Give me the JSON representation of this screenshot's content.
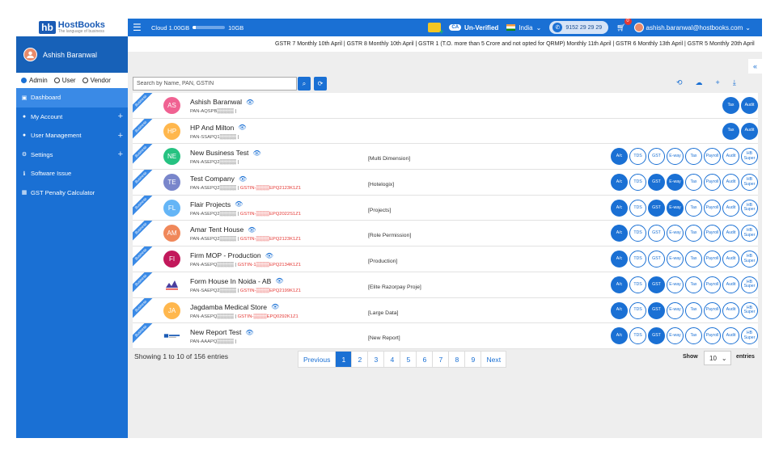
{
  "brand": {
    "logo_mark": "hb",
    "name": "HostBooks",
    "tagline": "The language of business"
  },
  "user": {
    "name": "Ashish Baranwal",
    "email": "ashish.baranwal@hostbooks.com"
  },
  "roles": [
    {
      "label": "Admin",
      "selected": true
    },
    {
      "label": "User",
      "selected": false
    },
    {
      "label": "Vendor",
      "selected": false
    }
  ],
  "nav": [
    {
      "label": "Dashboard",
      "icon": "dashboard-icon",
      "active": true,
      "expandable": false
    },
    {
      "label": "My Account",
      "icon": "account-icon",
      "active": false,
      "expandable": true
    },
    {
      "label": "User Management",
      "icon": "users-icon",
      "active": false,
      "expandable": true
    },
    {
      "label": "Settings",
      "icon": "gear-icon",
      "active": false,
      "expandable": true
    },
    {
      "label": "Software Issue",
      "icon": "info-icon",
      "active": false,
      "expandable": false
    },
    {
      "label": "GST Penalty Calculator",
      "icon": "calculator-icon",
      "active": false,
      "expandable": false
    }
  ],
  "topbar": {
    "storage_label": "Cloud 1.00GB",
    "storage_total": "10GB",
    "storage_used_fraction": 0.1,
    "ca_badge": "CA",
    "verify_status": "Un-Verified",
    "country": "India",
    "phone": "9152 29 29 29",
    "cart_count": "0"
  },
  "ticker": "GSTR 7 Monthly 10th April | GSTR 8 Monthly 10th April | GSTR 1 (T.O. more than 5 Crore and not opted for QRMP) Monthly 11th April | GSTR 6 Monthly 13th April | GSTR 5 Monthly 20th April",
  "search": {
    "placeholder": "Search by Name, PAN, GSTIN"
  },
  "row_ribbon": "Business",
  "companies": [
    {
      "initials": "AS",
      "color": "#f06292",
      "name": "Ashish Baranwal",
      "pan": "PAN-AQSPB▒▒▒▒▒ |",
      "gstin": "",
      "module": "",
      "modules": [
        "Tax",
        "Audit"
      ],
      "active": [
        "Tax",
        "Audit"
      ]
    },
    {
      "initials": "HP",
      "color": "#ffb74d",
      "name": "HP And Milton",
      "pan": "PAN-SSAPQ1▒▒▒▒▒ |",
      "gstin": "",
      "module": "",
      "modules": [
        "Tax",
        "Audit"
      ],
      "active": [
        "Tax",
        "Audit"
      ]
    },
    {
      "initials": "NE",
      "color": "#26c281",
      "name": "New Business Test",
      "pan": "PAN-ASEPQ2▒▒▒▒▒ |",
      "gstin": "",
      "module": "[Multi Dimension]",
      "modules": [
        "A/c",
        "TDS",
        "GST",
        "E-way",
        "Tax",
        "Payroll",
        "Audit",
        "HB Super"
      ],
      "active": [
        "A/c"
      ]
    },
    {
      "initials": "TE",
      "color": "#7986cb",
      "name": "Test Company",
      "pan": "PAN-ASEPQ2▒▒▒▒▒ |",
      "gstin": "GSTIN-▒▒▒▒EPQ2123K1Z1",
      "module": "[Hotelogix]",
      "modules": [
        "A/c",
        "TDS",
        "GST",
        "E-way",
        "Tax",
        "Payroll",
        "Audit",
        "HB Super"
      ],
      "active": [
        "A/c",
        "GST",
        "E-way"
      ]
    },
    {
      "initials": "FL",
      "color": "#64b5f6",
      "name": "Flair Projects",
      "pan": "PAN-ASEPQ2▒▒▒▒▒ |",
      "gstin": "GSTIN-▒▒▒▒EPQ2022S1Z1",
      "module": "[Projects]",
      "modules": [
        "A/c",
        "TDS",
        "GST",
        "E-way",
        "Tax",
        "Payroll",
        "Audit",
        "HB Super"
      ],
      "active": [
        "A/c",
        "GST",
        "E-way"
      ]
    },
    {
      "initials": "AM",
      "color": "#f0885a",
      "name": "Amar Tent House",
      "pan": "PAN-ASEPQ2▒▒▒▒▒ |",
      "gstin": "GSTIN-▒▒▒▒EPQ2123K1Z1",
      "module": "[Role Permission]",
      "modules": [
        "A/c",
        "TDS",
        "GST",
        "E-way",
        "Tax",
        "Payroll",
        "Audit",
        "HB Super"
      ],
      "active": [
        "A/c"
      ]
    },
    {
      "initials": "FI",
      "color": "#c2185b",
      "name": "Firm MOP - Production",
      "pan": "PAN-ASEPQ▒▒▒▒▒ |",
      "gstin": "GSTIN-1▒▒▒▒EPQ2134K1Z1",
      "module": "[Production]",
      "modules": [
        "A/c",
        "TDS",
        "GST",
        "E-way",
        "Tax",
        "Payroll",
        "Audit",
        "HB Super"
      ],
      "active": [
        "A/c"
      ]
    },
    {
      "initials": "",
      "color": "logo",
      "name": "Form House In Noida - AB",
      "pan": "PAN-SAEPQ2▒▒▒▒▒ |",
      "gstin": "GSTIN-▒▒▒▒EPQ2199K1Z1",
      "module": "[Elite Razorpay Proje]",
      "modules": [
        "A/c",
        "TDS",
        "GST",
        "E-way",
        "Tax",
        "Payroll",
        "Audit",
        "HB Super"
      ],
      "active": [
        "A/c",
        "GST"
      ]
    },
    {
      "initials": "JA",
      "color": "#ffb74d",
      "name": "Jagdamba Medical Store",
      "pan": "PAN-ASEPQ▒▒▒▒▒ |",
      "gstin": "GSTIN-▒▒▒▒EPQ0292K1Z1",
      "module": "[Large Data]",
      "modules": [
        "A/c",
        "TDS",
        "GST",
        "E-way",
        "Tax",
        "Payroll",
        "Audit",
        "HB Super"
      ],
      "active": [
        "A/c",
        "GST"
      ]
    },
    {
      "initials": "",
      "color": "hostbooks-logo",
      "name": "New Report Test",
      "pan": "PAN-AAAPQ▒▒▒▒▒ |",
      "gstin": "",
      "module": "[New Report]",
      "modules": [
        "A/c",
        "TDS",
        "GST",
        "E-way",
        "Tax",
        "Payroll",
        "Audit",
        "HB Super"
      ],
      "active": [
        "A/c",
        "GST"
      ]
    }
  ],
  "footer": {
    "summary": "Showing 1 to 10 of 156 entries",
    "previous": "Previous",
    "next": "Next",
    "pages": [
      "1",
      "2",
      "3",
      "4",
      "5",
      "6",
      "7",
      "8",
      "9"
    ],
    "current_page": "1",
    "show_label": "Show",
    "page_size": "10",
    "entries_label": "entries"
  }
}
